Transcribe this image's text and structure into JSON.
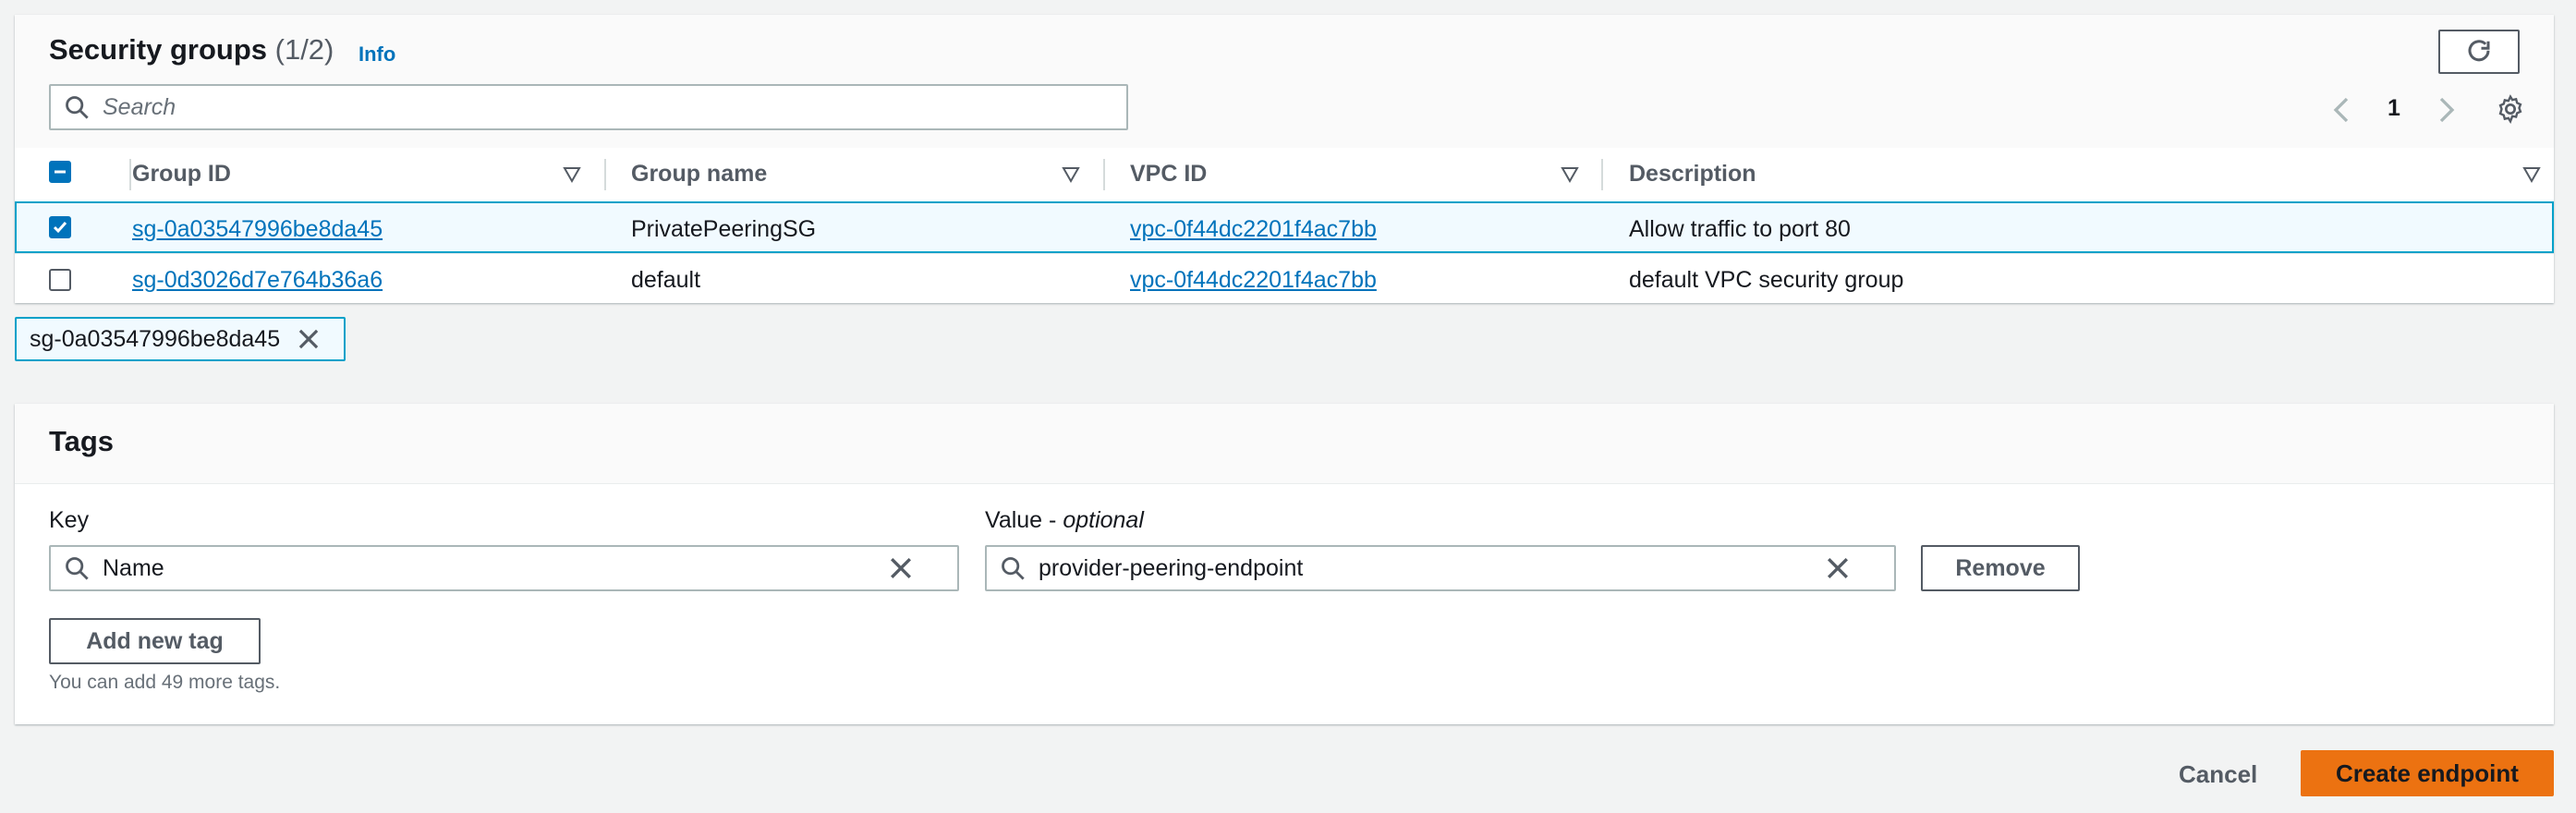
{
  "security_groups": {
    "title": "Security groups",
    "count": "(1/2)",
    "info_label": "Info",
    "search_placeholder": "Search",
    "page_number": "1",
    "columns": [
      "Group ID",
      "Group name",
      "VPC ID",
      "Description"
    ],
    "rows": [
      {
        "group_id": "sg-0a03547996be8da45",
        "group_name": "PrivatePeeringSG",
        "vpc_id": "vpc-0f44dc2201f4ac7bb",
        "description": "Allow traffic to port 80",
        "selected": true
      },
      {
        "group_id": "sg-0d3026d7e764b36a6",
        "group_name": "default",
        "vpc_id": "vpc-0f44dc2201f4ac7bb",
        "description": "default VPC security group",
        "selected": false
      }
    ],
    "selected_token": "sg-0a03547996be8da45"
  },
  "tags": {
    "title": "Tags",
    "key_label": "Key",
    "value_label": "Value - ",
    "value_label_optional": "optional",
    "key_value": "Name",
    "value_value": "provider-peering-endpoint",
    "remove_label": "Remove",
    "add_label": "Add new tag",
    "hint": "You can add 49 more tags."
  },
  "footer": {
    "cancel_label": "Cancel",
    "create_label": "Create endpoint"
  },
  "colors": {
    "link": "#0073bb",
    "primary": "#ec7211",
    "selected_border": "#00a1c9",
    "selected_bg": "#f1faff"
  }
}
